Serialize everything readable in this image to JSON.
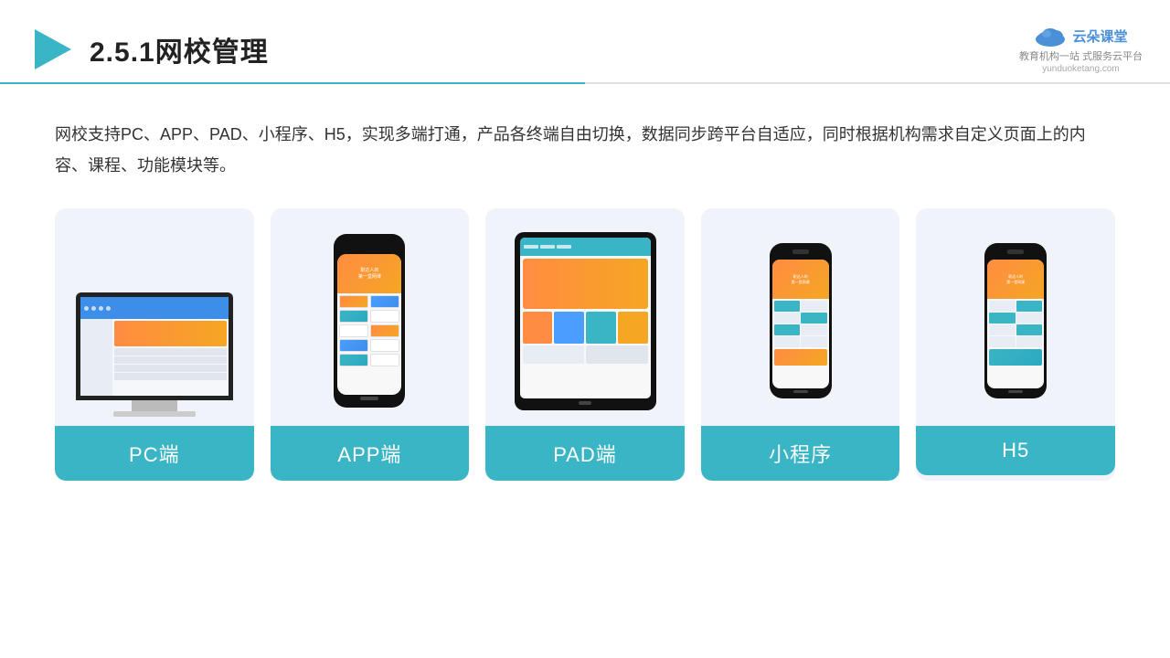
{
  "header": {
    "title": "2.5.1网校管理",
    "logo": {
      "name": "云朵课堂",
      "domain": "yunduoketang.com",
      "tagline": "教育机构一站\n式服务云平台"
    }
  },
  "description": "网校支持PC、APP、PAD、小程序、H5，实现多端打通，产品各终端自由切换，数据同步跨平台自适应，同时根据机构需求自定义页面上的内容、课程、功能模块等。",
  "devices": [
    {
      "id": "pc",
      "label": "PC端"
    },
    {
      "id": "app",
      "label": "APP端"
    },
    {
      "id": "pad",
      "label": "PAD端"
    },
    {
      "id": "miniprogram",
      "label": "小程序"
    },
    {
      "id": "h5",
      "label": "H5"
    }
  ],
  "colors": {
    "accent": "#3ab5c6",
    "orange": "#ff8c42",
    "blue": "#4a9eff",
    "bg_card": "#f0f4fa"
  }
}
